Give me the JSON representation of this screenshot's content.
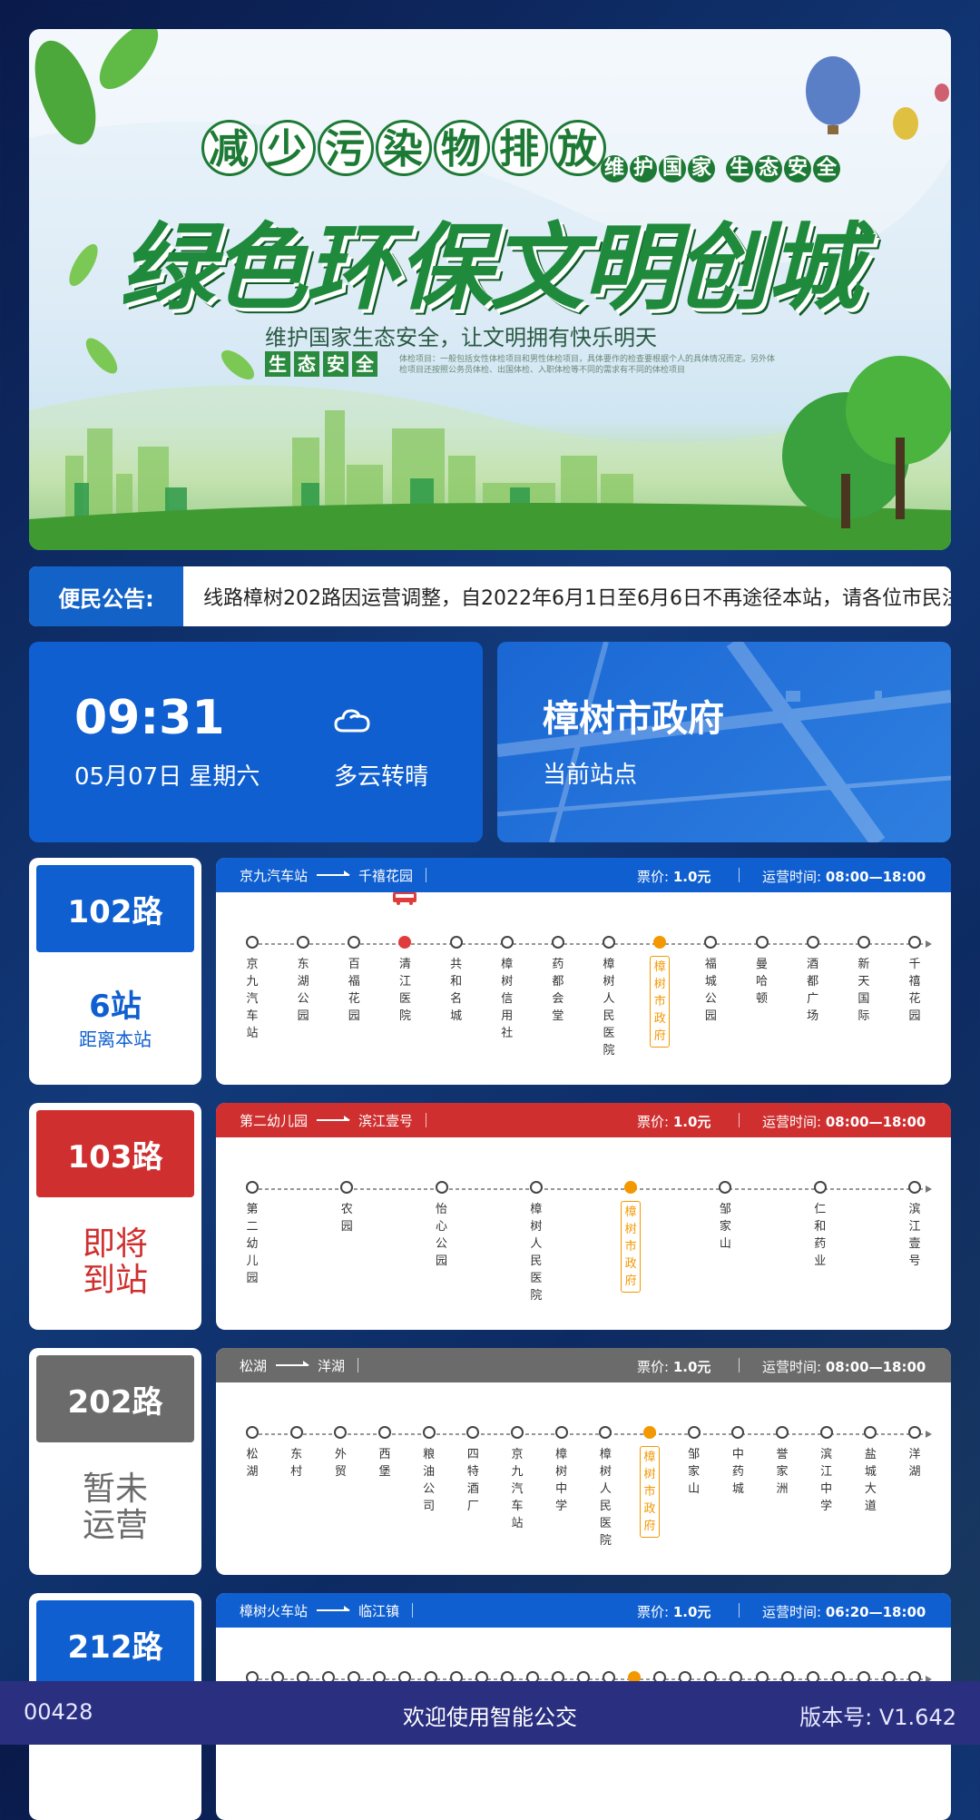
{
  "banner": {
    "tag_chars": [
      "减",
      "少",
      "污",
      "染",
      "物",
      "排",
      "放"
    ],
    "side_tag_chars": [
      "维",
      "护",
      "国",
      "家",
      " ",
      "生",
      "态",
      "安",
      "全"
    ],
    "title": "绿色环保文明创城",
    "slogan": "维护国家生态安全，让文明拥有快乐明天",
    "small_tag_chars": [
      "生",
      "态",
      "安",
      "全"
    ],
    "fine_print": "体检项目：一般包括女性体检项目和男性体检项目，具体要作的检查要根据个人的具体情况而定。另外体检项目还按照公务员体检、出国体检、入职体检等不同的需求有不同的体检项目"
  },
  "notice": {
    "label": "便民公告:",
    "text": "线路樟树202路因运营调整，自2022年6月1日至6月6日不再途径本站，请各位市民注"
  },
  "clock": {
    "time": "09:31",
    "date": "05月07日 星期六",
    "weather": "多云转晴",
    "weather_icon": "cloud-icon"
  },
  "station": {
    "name": "樟树市政府",
    "label": "当前站点"
  },
  "routes": [
    {
      "number": "102路",
      "color": "#0f5fd0",
      "status_type": "distance",
      "status_main": "6站",
      "status_sub": "距离本站",
      "from": "京九汽车站",
      "to": "千禧花园",
      "price_label": "票价:",
      "price": "1.0元",
      "hours_label": "运营时间:",
      "hours": "08:00—18:00",
      "current_index": 8,
      "bus_index": 3,
      "stops": [
        "京九汽车站",
        "东湖公园",
        "百福花园",
        "清江医院",
        "共和名城",
        "樟树信用社",
        "药都会堂",
        "樟树人民医院",
        "樟树市政府",
        "福城公园",
        "曼哈顿",
        "酒都广场",
        "新天国际",
        "千禧花园"
      ]
    },
    {
      "number": "103路",
      "color": "#cf2f2f",
      "status_type": "text",
      "status_main": "即将到站",
      "status_color": "#cf2f2f",
      "from": "第二幼儿园",
      "to": "滨江壹号",
      "price_label": "票价:",
      "price": "1.0元",
      "hours_label": "运营时间:",
      "hours": "08:00—18:00",
      "current_index": 4,
      "bus_index": -1,
      "stops": [
        "第二幼儿园",
        "农园",
        "怡心公园",
        "樟树人民医院",
        "樟树市政府",
        "邹家山",
        "仁和药业",
        "滨江壹号"
      ]
    },
    {
      "number": "202路",
      "color": "#6b6b6b",
      "status_type": "text",
      "status_main": "暂未运营",
      "status_color": "#6b6b6b",
      "from": "松湖",
      "to": "洋湖",
      "price_label": "票价:",
      "price": "1.0元",
      "hours_label": "运营时间:",
      "hours": "08:00—18:00",
      "current_index": 9,
      "bus_index": -1,
      "stops": [
        "松湖",
        "东村",
        "外贸",
        "西堡",
        "粮油公司",
        "四特酒厂",
        "京九汽车站",
        "樟树中学",
        "樟树人民医院",
        "樟树市政府",
        "邹家山",
        "中药城",
        "誉家洲",
        "滨江中学",
        "盐城大道",
        "洋湖"
      ]
    },
    {
      "number": "212路",
      "color": "#0f5fd0",
      "status_type": "none",
      "from": "樟树火车站",
      "to": "临江镇",
      "price_label": "票价:",
      "price": "1.0元",
      "hours_label": "运营时间:",
      "hours": "06:20—18:00",
      "current_index": 15,
      "bus_index": -1,
      "stops": [
        "",
        "",
        "",
        "",
        "",
        "",
        "",
        "",
        "",
        "",
        "",
        "",
        "",
        "",
        "",
        "",
        "",
        "",
        "",
        "",
        "",
        "",
        "",
        "",
        "",
        "",
        ""
      ]
    }
  ],
  "footer": {
    "device_id": "00428",
    "welcome": "欢迎使用智能公交",
    "version": "版本号:  V1.642"
  }
}
